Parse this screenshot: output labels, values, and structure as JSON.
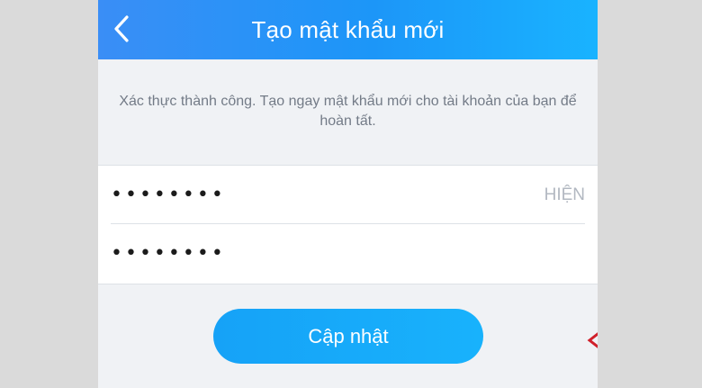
{
  "header": {
    "title": "Tạo mật khẩu mới",
    "back_icon": "chevron-left-icon"
  },
  "instruction": {
    "text": "Xác thực thành công. Tạo ngay mật khẩu mới cho tài khoản của bạn để hoàn tất."
  },
  "form": {
    "new_password_value": "••••••••",
    "confirm_password_value": "••••••••",
    "show_label": "HIỆN"
  },
  "actions": {
    "update_label": "Cập nhật"
  },
  "annotation": {
    "arrow_icon": "arrow-left-outline-icon",
    "arrow_color": "#d0202a"
  },
  "colors": {
    "header_gradient_start": "#3a8ef6",
    "header_gradient_end": "#19b3ff",
    "button_color": "#18aaf9",
    "background": "#f0f2f5"
  }
}
